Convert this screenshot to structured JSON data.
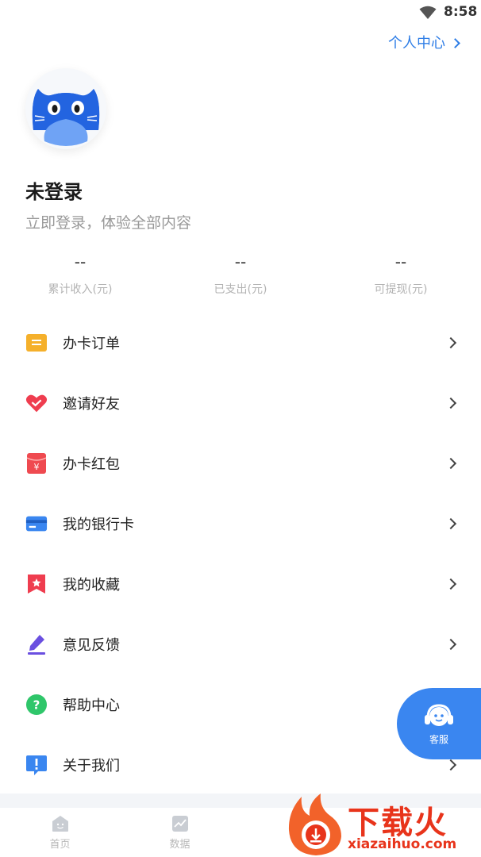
{
  "status": {
    "time": "8:58"
  },
  "header": {
    "personal_center": "个人中心"
  },
  "user": {
    "title": "未登录",
    "subtitle": "立即登录，体验全部内容"
  },
  "stats": [
    {
      "value": "--",
      "label": "累计收入(元)"
    },
    {
      "value": "--",
      "label": "已支出(元)"
    },
    {
      "value": "--",
      "label": "可提现(元)"
    }
  ],
  "menu": [
    {
      "label": "办卡订单",
      "icon": "order-icon",
      "color": "#f5b02b"
    },
    {
      "label": "邀请好友",
      "icon": "heart-icon",
      "color": "#ef3d4f"
    },
    {
      "label": "办卡红包",
      "icon": "red-packet-icon",
      "color": "#ef4a50"
    },
    {
      "label": "我的银行卡",
      "icon": "bank-card-icon",
      "color": "#3a86f0"
    },
    {
      "label": "我的收藏",
      "icon": "bookmark-star-icon",
      "color": "#ef3d4f"
    },
    {
      "label": "意见反馈",
      "icon": "pen-icon",
      "color": "#6a4fe0"
    },
    {
      "label": "帮助中心",
      "icon": "help-icon",
      "color": "#2fc66a"
    },
    {
      "label": "关于我们",
      "icon": "info-icon",
      "color": "#3a86f0"
    }
  ],
  "service": {
    "label": "客服"
  },
  "tabs": [
    {
      "label": "首页"
    },
    {
      "label": "数据"
    }
  ],
  "watermark": {
    "text": "下载火",
    "url": "xiazaihuo.com"
  },
  "colors": {
    "accent": "#3a86f0",
    "link": "#2e7de6",
    "watermark": "#e8341b"
  }
}
